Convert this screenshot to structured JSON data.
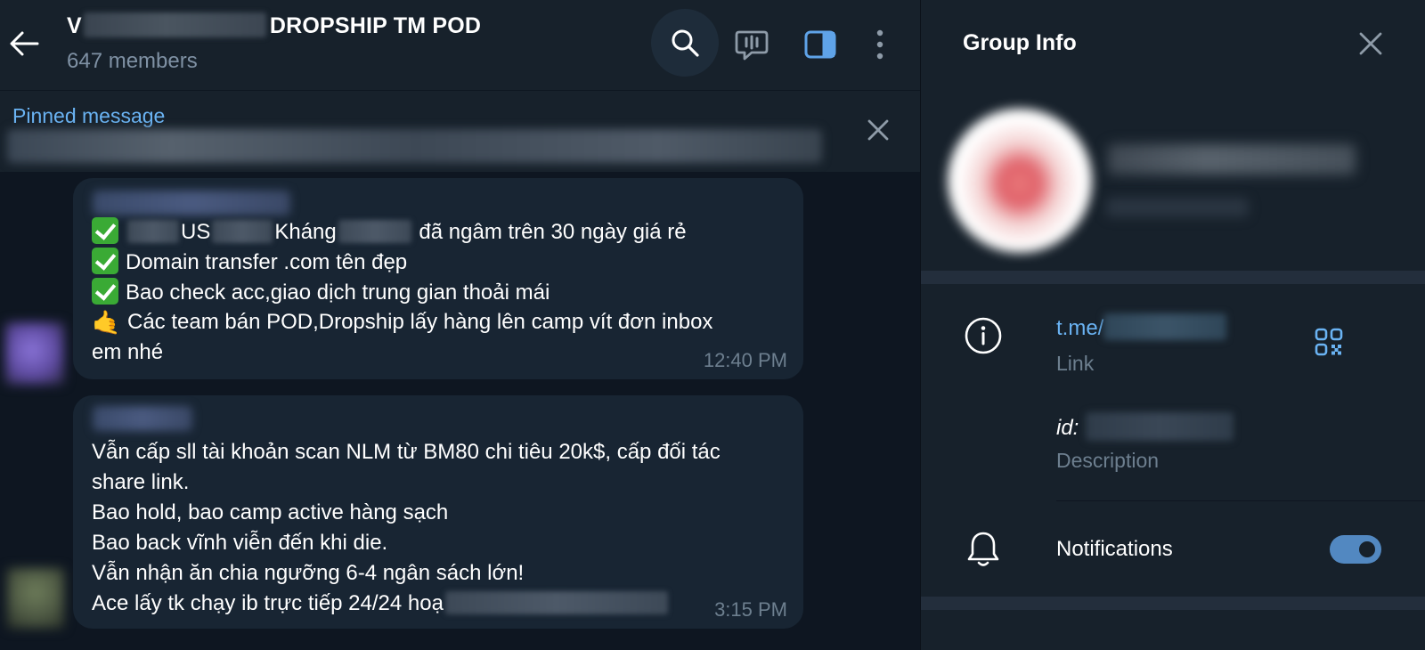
{
  "chat": {
    "title_prefix": "V",
    "title_suffix": "DROPSHIP TM POD",
    "members": "647 members",
    "pinned": {
      "label": "Pinned message"
    }
  },
  "messages": [
    {
      "lines": [
        {
          "icon": "check-mark-icon",
          "parts": [
            "",
            "US",
            "Kháng",
            "đã ngâm trên 30 ngày giá rẻ"
          ]
        },
        {
          "icon": "check-mark-icon",
          "text": "Domain transfer .com tên đẹp"
        },
        {
          "icon": "check-mark-icon",
          "text": "Bao check acc,giao dịch trung gian thoải mái"
        },
        {
          "icon": "call-me-hand-icon",
          "text": "Các team bán POD,Dropship lấy hàng lên camp vít đơn inbox"
        },
        {
          "text": "em nhé"
        }
      ],
      "time": "12:40 PM"
    },
    {
      "lines": [
        {
          "text": "Vẫn cấp sll tài khoản scan NLM từ BM80 chi tiêu 20k$, cấp đối tác"
        },
        {
          "text": "share link."
        },
        {
          "text": "Bao hold, bao camp active hàng sạch"
        },
        {
          "text": "Bao back vĩnh viễn đến khi die."
        },
        {
          "text": "Vẫn nhận ăn chia ngưỡng 6-4 ngân sách lớn!"
        },
        {
          "text": "Ace lấy tk chạy ib trực tiếp 24/24 hoạ"
        }
      ],
      "time": "3:15 PM"
    }
  ],
  "info": {
    "title": "Group Info",
    "link_prefix": "t.me/",
    "link_caption": "Link",
    "id_prefix": "id:",
    "description_caption": "Description",
    "notifications_label": "Notifications",
    "notifications_on": true
  },
  "colors": {
    "accent": "#6ab3f3",
    "toggle": "#5288c1",
    "panel_bg": "#17212b",
    "chat_bg": "#0e1621",
    "bubble_bg": "#182533"
  }
}
